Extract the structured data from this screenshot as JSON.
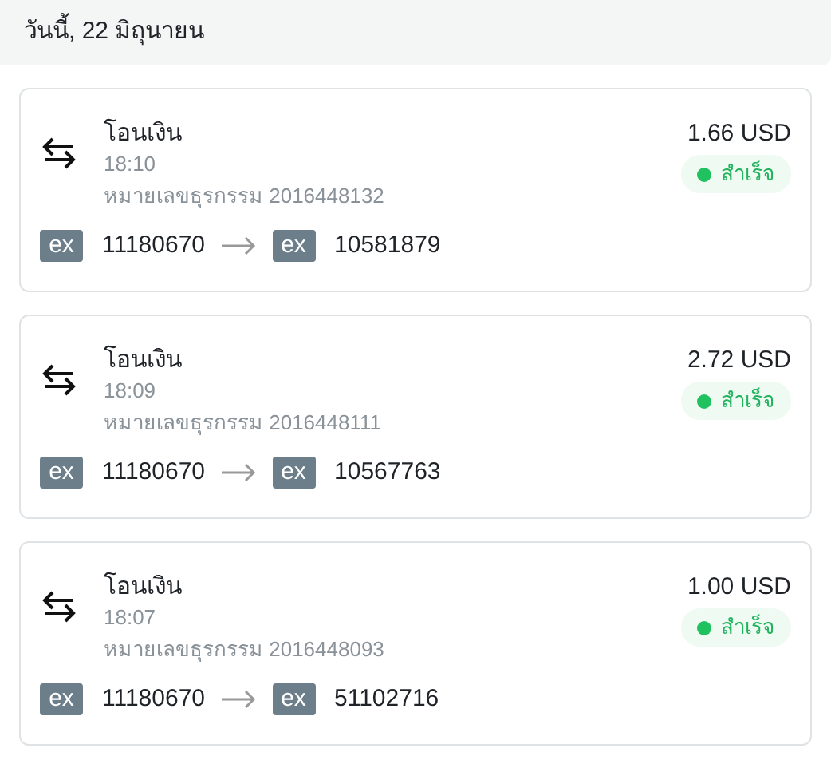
{
  "header": {
    "title": "วันนี้, 22 มิถุนายน"
  },
  "transactions": [
    {
      "type": "โอนเงิน",
      "time": "18:10",
      "reference": "หมายเลขธุรกรรม 2016448132",
      "amount": "1.66 USD",
      "status": {
        "kind": "success",
        "label": "สำเร็จ"
      },
      "from": {
        "logo": "ex",
        "account": "11180670"
      },
      "to": {
        "logo": "ex",
        "account": "10581879"
      }
    },
    {
      "type": "โอนเงิน",
      "time": "18:09",
      "reference": "หมายเลขธุรกรรม 2016448111",
      "amount": "2.72 USD",
      "status": {
        "kind": "success",
        "label": "สำเร็จ"
      },
      "from": {
        "logo": "ex",
        "account": "11180670"
      },
      "to": {
        "logo": "ex",
        "account": "10567763"
      }
    },
    {
      "type": "โอนเงิน",
      "time": "18:07",
      "reference": "หมายเลขธุรกรรม 2016448093",
      "amount": "1.00 USD",
      "status": {
        "kind": "success",
        "label": "สำเร็จ"
      },
      "from": {
        "logo": "ex",
        "account": "11180670"
      },
      "to": {
        "logo": "ex",
        "account": "51102716"
      }
    }
  ]
}
